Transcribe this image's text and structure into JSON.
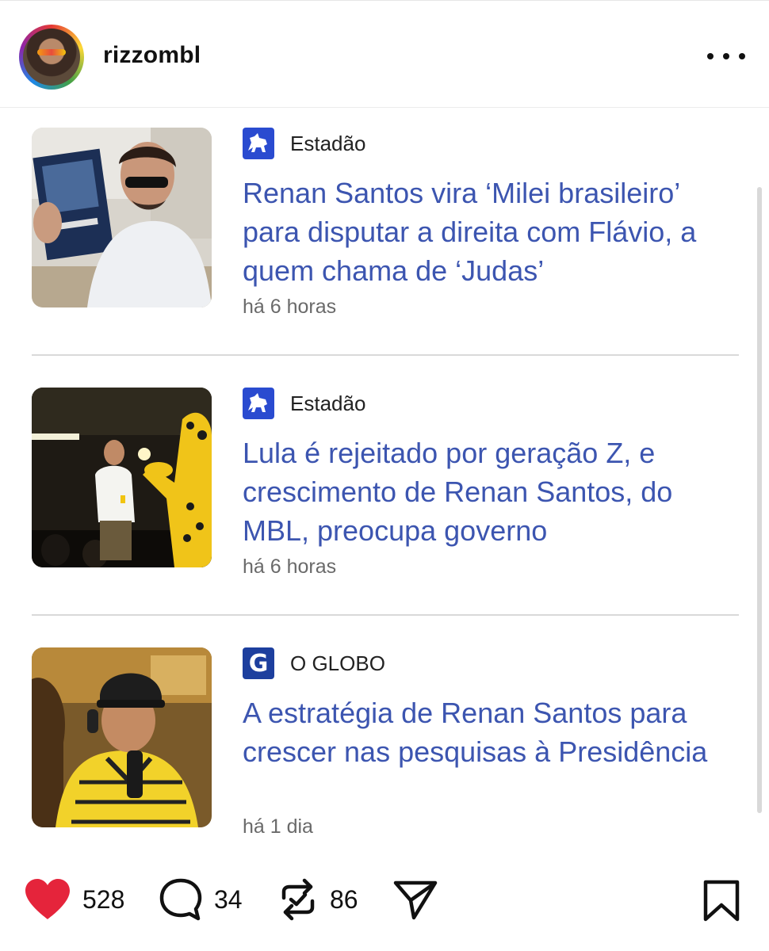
{
  "post": {
    "username": "rizzombl",
    "more_icon": "more-horizontal-icon"
  },
  "news": [
    {
      "source": "Estadão",
      "source_logo": "estadao-horse-logo",
      "headline": "Renan Santos vira ‘Milei brasileiro’ para disputar a direita com Flávio, a quem chama de ‘Judas’",
      "time": "há 6 horas"
    },
    {
      "source": "Estadão",
      "source_logo": "estadao-horse-logo",
      "headline": "Lula é rejeitado por geração Z, e crescimento de Renan Santos, do MBL, preocupa governo",
      "time": "há 6 horas"
    },
    {
      "source": "O GLOBO",
      "source_logo": "globo-g-logo",
      "logo_letter": "G",
      "headline": "A estratégia de Renan Santos para crescer nas pesquisas à Presidência",
      "time": "há 1 dia"
    }
  ],
  "actions": {
    "likes": "528",
    "comments": "34",
    "reposts": "86"
  },
  "colors": {
    "headline": "#3c55b0",
    "like": "#e5243b"
  }
}
